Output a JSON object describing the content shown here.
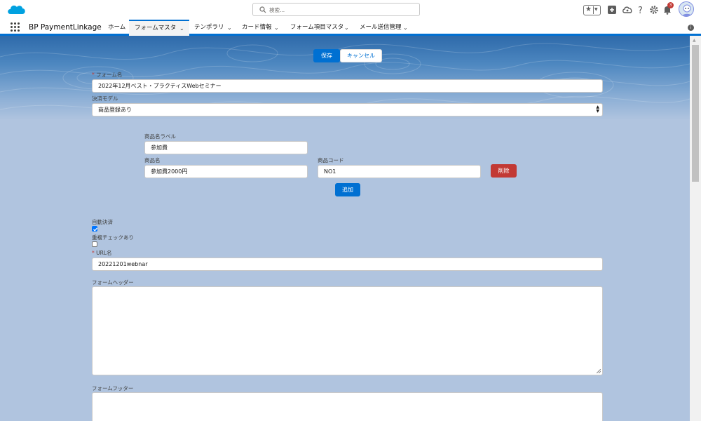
{
  "header": {
    "search_placeholder": "検索...",
    "notification_count": "3"
  },
  "nav": {
    "app_name": "BP PaymentLinkage",
    "items": [
      {
        "label": "ホーム"
      },
      {
        "label": "フォームマスタ"
      },
      {
        "label": "テンポラリ"
      },
      {
        "label": "カード情報"
      },
      {
        "label": "フォーム項目マスタ"
      },
      {
        "label": "メール送信管理"
      }
    ],
    "active_index": 1
  },
  "form": {
    "save_label": "保存",
    "cancel_label": "キャンセル",
    "form_name_label": "フォーム名",
    "form_name_value": "2022年12月ベスト・プラクティスWebセミナー",
    "payment_model_label": "決済モデル",
    "payment_model_value": "商品登録あり",
    "product_label_label": "商品名ラベル",
    "product_label_value": "参加費",
    "product_name_label": "商品名",
    "product_name_value": "参加費2000円",
    "product_code_label": "商品コード",
    "product_code_value": "NO1",
    "delete_label": "削除",
    "add_label": "追加",
    "auto_payment_label": "自動決済",
    "auto_payment_checked": true,
    "dup_check_label": "重複チェックあり",
    "dup_check_checked": false,
    "url_name_label": "URL名",
    "url_name_value": "20221201webnar",
    "form_header_label": "フォームヘッダー",
    "form_footer_label": "フォームフッター",
    "required_mark": "*"
  },
  "colors": {
    "brand": "#0070d2",
    "danger": "#c23934"
  }
}
